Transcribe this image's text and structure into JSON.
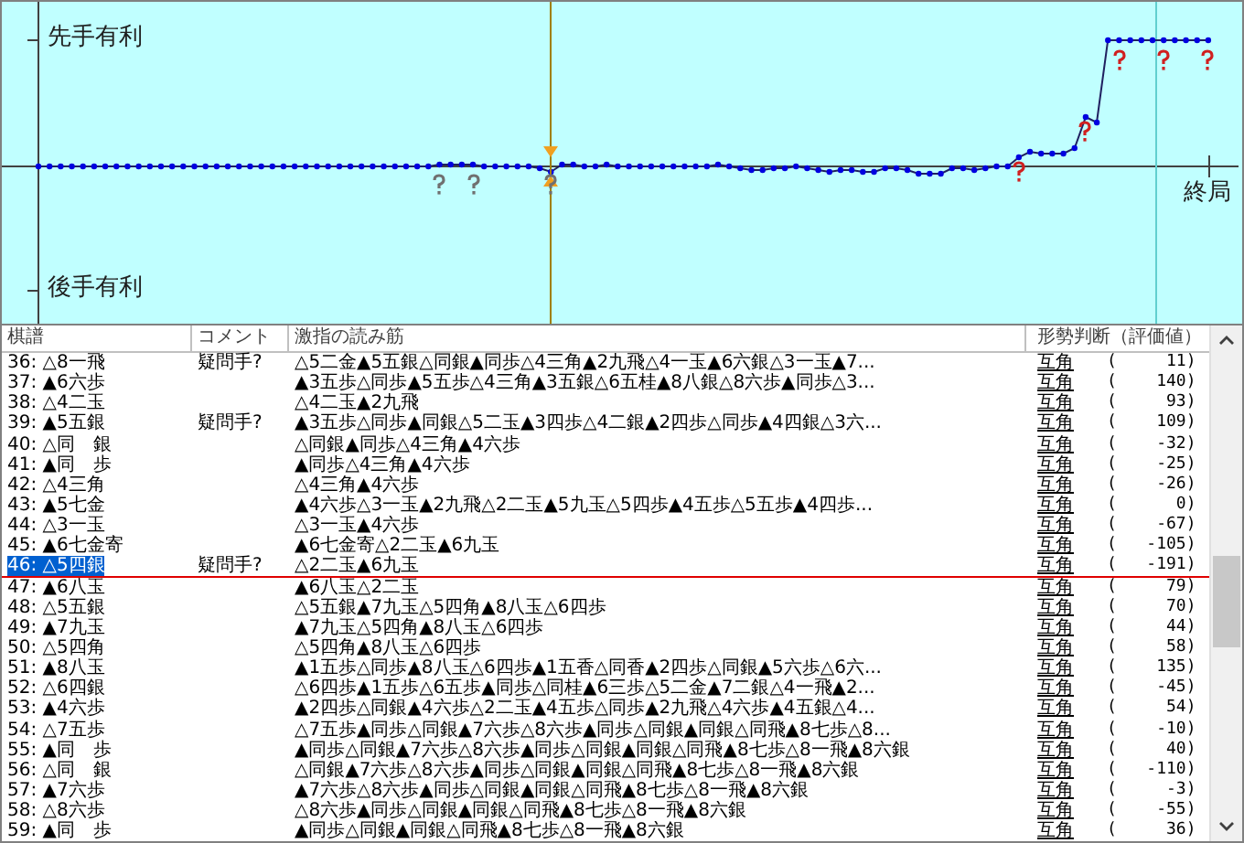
{
  "chart": {
    "label_top": "先手有利",
    "label_bottom": "後手有利",
    "label_end": "終局"
  },
  "table": {
    "columns": [
      "棋譜",
      "コメント",
      "激指の読み筋",
      "形勢判断（評価値）"
    ],
    "rows": [
      {
        "move": "36: △8一飛",
        "comment": "疑問手?",
        "pv": "△5二金▲5五銀△同銀▲同歩△4三角▲2九飛△4一玉▲6六銀△3一玉▲7...",
        "judgement": "互角",
        "eval": "(     11)",
        "selected": false
      },
      {
        "move": "37: ▲6六歩",
        "pv": "▲3五歩△同歩▲5五歩△4三角▲3五銀△6五桂▲8八銀△8六歩▲同歩△3...",
        "judgement": "互角",
        "eval": "(    140)",
        "selected": false
      },
      {
        "move": "38: △4二玉",
        "pv": "△4二玉▲2九飛",
        "judgement": "互角",
        "eval": "(     93)",
        "selected": false
      },
      {
        "move": "39: ▲5五銀",
        "comment": "疑問手?",
        "pv": "▲3五歩△同歩▲同銀△5二玉▲3四歩△4二銀▲2四歩△同歩▲4四銀△3六...",
        "judgement": "互角",
        "eval": "(    109)",
        "selected": false
      },
      {
        "move": "40: △同　銀",
        "pv": "△同銀▲同歩△4三角▲4六歩",
        "judgement": "互角",
        "eval": "(    -32)",
        "selected": false
      },
      {
        "move": "41: ▲同　歩",
        "pv": "▲同歩△4三角▲4六歩",
        "judgement": "互角",
        "eval": "(    -25)",
        "selected": false
      },
      {
        "move": "42: △4三角",
        "pv": "△4三角▲4六歩",
        "judgement": "互角",
        "eval": "(    -26)",
        "selected": false
      },
      {
        "move": "43: ▲5七金",
        "pv": "▲4六歩△3一玉▲2九飛△2二玉▲5九玉△5四歩▲4五歩△5五歩▲4四歩...",
        "judgement": "互角",
        "eval": "(      0)",
        "selected": false
      },
      {
        "move": "44: △3一玉",
        "pv": "△3一玉▲4六歩",
        "judgement": "互角",
        "eval": "(    -67)",
        "selected": false
      },
      {
        "move": "45: ▲6七金寄",
        "pv": "▲6七金寄△2二玉▲6九玉",
        "judgement": "互角",
        "eval": "(   -105)",
        "selected": false
      },
      {
        "move": "46: △5四銀",
        "comment": "疑問手?",
        "pv": "△2二玉▲6九玉",
        "judgement": "互角",
        "eval": "(   -191)",
        "selected": true
      },
      {
        "move": "47: ▲6八玉",
        "pv": "▲6八玉△2二玉",
        "judgement": "互角",
        "eval": "(     79)",
        "selected": false
      },
      {
        "move": "48: △5五銀",
        "pv": "△5五銀▲7九玉△5四角▲8八玉△6四歩",
        "judgement": "互角",
        "eval": "(     70)",
        "selected": false
      },
      {
        "move": "49: ▲7九玉",
        "pv": "▲7九玉△5四角▲8八玉△6四歩",
        "judgement": "互角",
        "eval": "(     44)",
        "selected": false
      },
      {
        "move": "50: △5四角",
        "pv": "△5四角▲8八玉△6四歩",
        "judgement": "互角",
        "eval": "(     58)",
        "selected": false
      },
      {
        "move": "51: ▲8八玉",
        "pv": "▲1五歩△同歩▲8八玉△6四歩▲1五香△同香▲2四歩△同銀▲5六歩△6六...",
        "judgement": "互角",
        "eval": "(    135)",
        "selected": false
      },
      {
        "move": "52: △6四銀",
        "pv": "△6四歩▲1五歩△6五歩▲同歩△同桂▲6三歩△5二金▲7二銀△4一飛▲2...",
        "judgement": "互角",
        "eval": "(    -45)",
        "selected": false
      },
      {
        "move": "53: ▲4六歩",
        "pv": "▲2四歩△同銀▲4六歩△2二玉▲4五歩△同歩▲2九飛△4六歩▲4五銀△4...",
        "judgement": "互角",
        "eval": "(     54)",
        "selected": false
      },
      {
        "move": "54: △7五歩",
        "pv": "△7五歩▲同歩△同銀▲7六歩△8六歩▲同歩△同銀▲同銀△同飛▲8七歩△8...",
        "judgement": "互角",
        "eval": "(    -10)",
        "selected": false
      },
      {
        "move": "55: ▲同　歩",
        "pv": "▲同歩△同銀▲7六歩△8六歩▲同歩△同銀▲同銀△同飛▲8七歩△8一飛▲8六銀",
        "judgement": "互角",
        "eval": "(     40)",
        "selected": false
      },
      {
        "move": "56: △同　銀",
        "pv": "△同銀▲7六歩△8六歩▲同歩△同銀▲同銀△同飛▲8七歩△8一飛▲8六銀",
        "judgement": "互角",
        "eval": "(   -110)",
        "selected": false
      },
      {
        "move": "57: ▲7六歩",
        "pv": "▲7六歩△8六歩▲同歩△同銀▲同銀△同飛▲8七歩△8一飛▲8六銀",
        "judgement": "互角",
        "eval": "(     -3)",
        "selected": false
      },
      {
        "move": "58: △8六歩",
        "pv": "△8六歩▲同歩△同銀▲同銀△同飛▲8七歩△8一飛▲8六銀",
        "judgement": "互角",
        "eval": "(    -55)",
        "selected": false
      },
      {
        "move": "59: ▲同　歩",
        "pv": "▲同歩△同銀▲同銀△同飛▲8七歩△8一飛▲8六銀",
        "judgement": "互角",
        "eval": "(     36)",
        "selected": false
      }
    ]
  }
}
